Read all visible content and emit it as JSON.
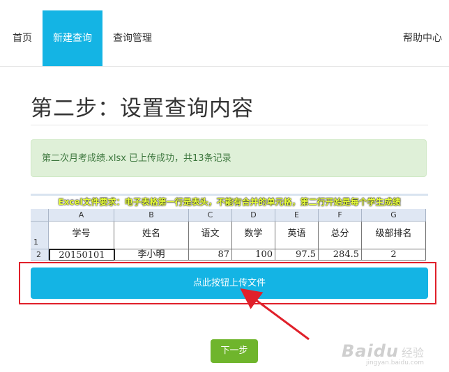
{
  "nav": {
    "home": "首页",
    "new_query": "新建查询",
    "query_manage": "查询管理",
    "help": "帮助中心"
  },
  "page_title": "第二步：设置查询内容",
  "alert_message": "第二次月考成绩.xlsx 已上传成功，共13条记录",
  "sheet": {
    "requirement_label": "Excel文件要求：",
    "requirement_text": "电子表格第一行是表头，不能有合并的单元格，第二行开始是每个学生成绩",
    "columns": [
      "A",
      "B",
      "C",
      "D",
      "E",
      "F",
      "G"
    ],
    "row_numbers": [
      "1",
      "2"
    ],
    "headers": [
      "学号",
      "姓名",
      "语文",
      "数学",
      "英语",
      "总分",
      "级部排名"
    ],
    "first_row": [
      "20150101",
      "李小明",
      "87",
      "100",
      "97.5",
      "284.5",
      "2"
    ]
  },
  "upload_button": "点此按钮上传文件",
  "next_button": "下一步",
  "watermark": {
    "logo": "Bai",
    "logo_suffix": "du",
    "cn": "经验",
    "url": "jingyan.baidu.com"
  },
  "colors": {
    "primary": "#14b4e4",
    "success_bg": "#dff0d8",
    "success_text": "#3c763d",
    "next_green": "#6fb52c",
    "highlight_red": "#e0202a"
  }
}
